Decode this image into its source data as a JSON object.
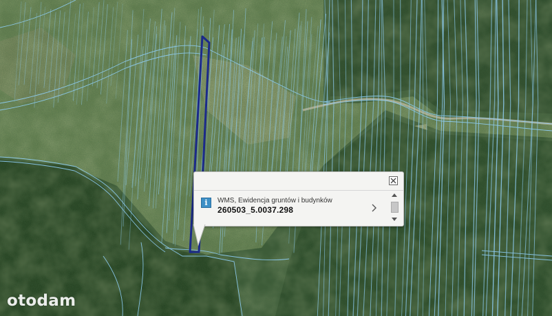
{
  "map": {
    "layer_type": "satellite-orthophoto",
    "parcel_line_color": "#7ec3f0",
    "highlight_color": "#1b2a8a"
  },
  "popup": {
    "info_icon": "info-icon",
    "info_glyph": "i",
    "layer_name": "WMS, Ewidencja gruntów i budynków",
    "parcel_id": "260503_5.0037.298",
    "close_icon": "close-icon",
    "next_icon": "chevron-right-icon"
  },
  "watermark": {
    "text": "otodam"
  }
}
